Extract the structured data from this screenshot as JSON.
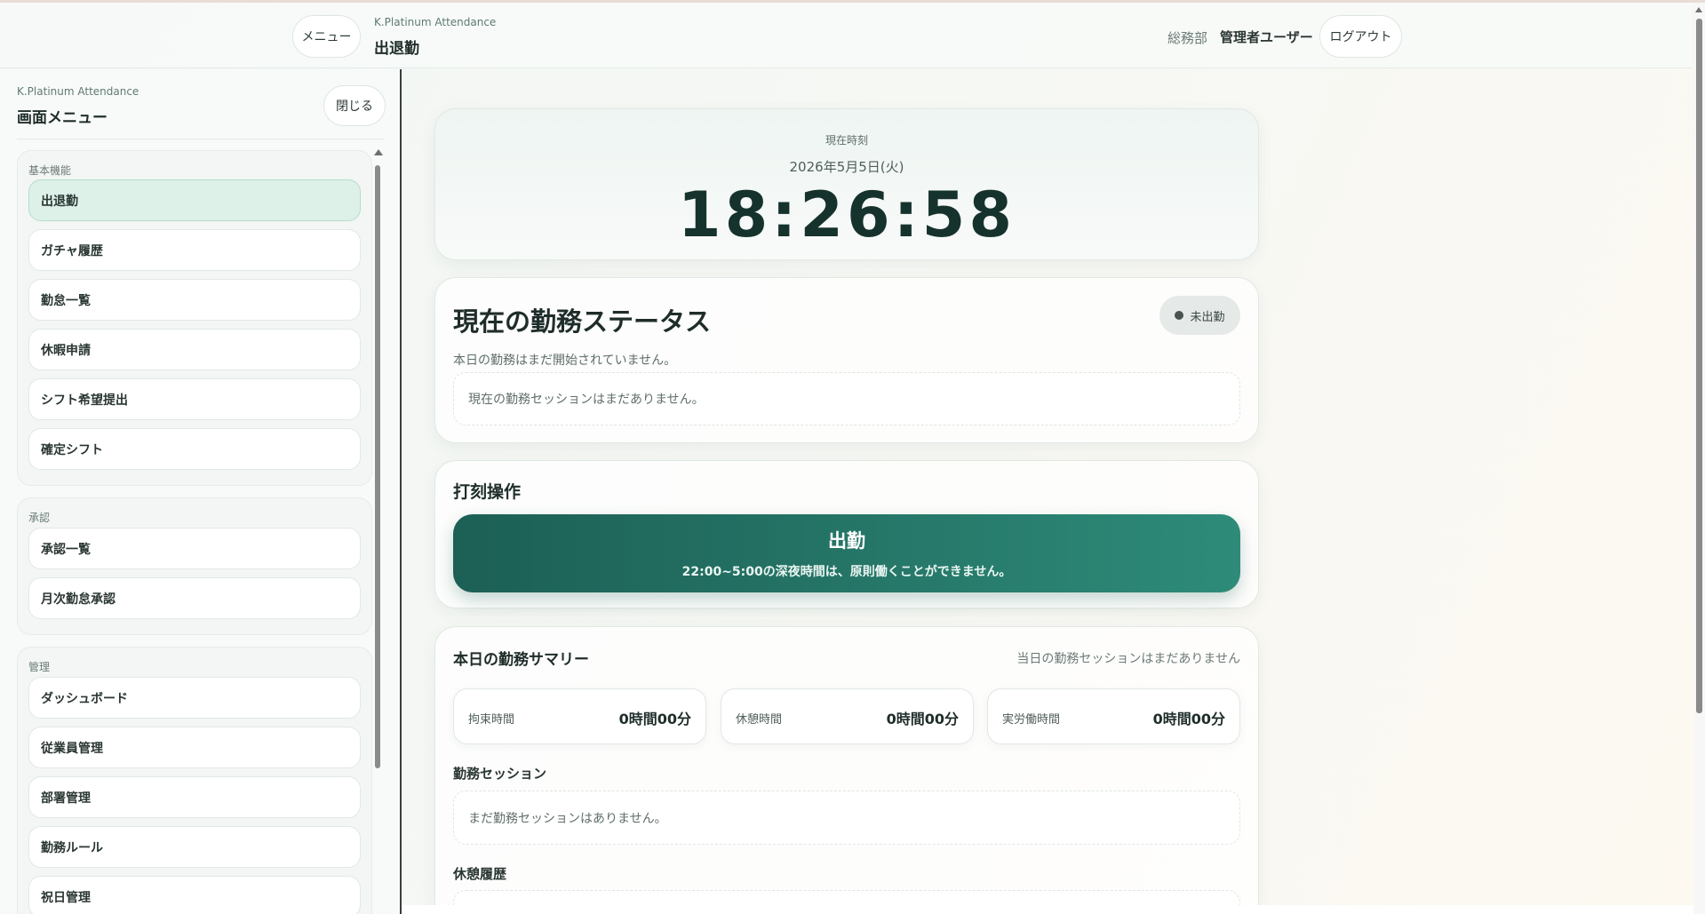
{
  "header": {
    "menu_label": "メニュー",
    "app_name": "K.Platinum Attendance",
    "page_title": "出退勤",
    "department": "総務部",
    "user_name": "管理者ユーザー",
    "logout_label": "ログアウト"
  },
  "sidebar": {
    "app_name": "K.Platinum Attendance",
    "title": "画面メニュー",
    "close_label": "閉じる",
    "groups": [
      {
        "label": "基本機能",
        "items": [
          {
            "label": "出退勤",
            "active": true
          },
          {
            "label": "ガチャ履歴"
          },
          {
            "label": "勤怠一覧"
          },
          {
            "label": "休暇申請"
          },
          {
            "label": "シフト希望提出"
          },
          {
            "label": "確定シフト"
          }
        ]
      },
      {
        "label": "承認",
        "items": [
          {
            "label": "承認一覧"
          },
          {
            "label": "月次勤怠承認"
          }
        ]
      },
      {
        "label": "管理",
        "items": [
          {
            "label": "ダッシュボード"
          },
          {
            "label": "従業員管理"
          },
          {
            "label": "部署管理"
          },
          {
            "label": "勤務ルール"
          },
          {
            "label": "祝日管理"
          }
        ]
      }
    ]
  },
  "clock": {
    "label": "現在時刻",
    "date": "2026年5月5日(火)",
    "time": "18:26:58"
  },
  "status": {
    "title": "現在の勤務ステータス",
    "badge": "未出勤",
    "subtitle": "本日の勤務はまだ開始されていません。",
    "session_message": "現在の勤務セッションはまだありません。"
  },
  "punch": {
    "title": "打刻操作",
    "button_label": "出勤",
    "button_note": "22:00~5:00の深夜時間は、原則働くことができません。"
  },
  "summary": {
    "title": "本日の勤務サマリー",
    "right_note": "当日の勤務セッションはまだありません",
    "metrics": [
      {
        "label": "拘束時間",
        "value": "0時間00分"
      },
      {
        "label": "休憩時間",
        "value": "0時間00分"
      },
      {
        "label": "実労働時間",
        "value": "0時間00分"
      }
    ],
    "sessions_label": "勤務セッション",
    "sessions_empty": "まだ勤務セッションはありません。",
    "breaks_label": "休憩履歴"
  },
  "colors": {
    "accent_start": "#1c5f55",
    "accent_end": "#2e8b79",
    "active_item": "#ddf1e8"
  }
}
